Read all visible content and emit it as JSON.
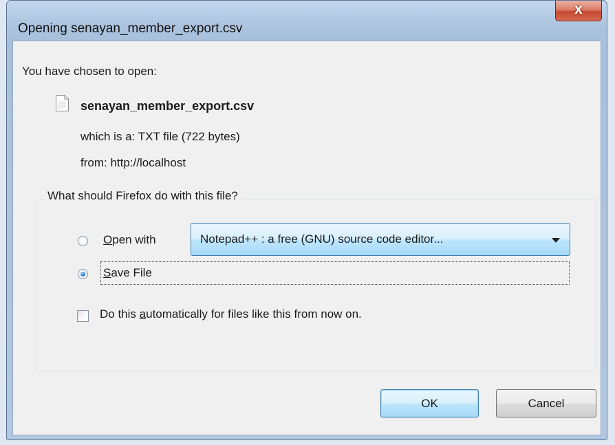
{
  "window": {
    "title": "Opening senayan_member_export.csv",
    "close_glyph": "x"
  },
  "dialog": {
    "prompt": "You have chosen to open:",
    "filename": "senayan_member_export.csv",
    "file_icon": "document-icon",
    "which_is": "which is a:  TXT file (722 bytes)",
    "from": "from:  http://localhost"
  },
  "group": {
    "legend": "What should Firefox do with this file?",
    "open_with": {
      "accel": "O",
      "rest": "pen with",
      "selected": false
    },
    "application": {
      "value": "Notepad++ : a free (GNU) source code editor..."
    },
    "save_file": {
      "accel": "S",
      "rest": "ave File",
      "selected": true
    },
    "auto": {
      "before": "Do this ",
      "accel": "a",
      "after": "utomatically for files like this from now on.",
      "checked": false
    }
  },
  "buttons": {
    "ok": "OK",
    "cancel": "Cancel"
  },
  "colors": {
    "accent": "#3c7fb1",
    "close": "#c44a30",
    "frame": "#b6cde6"
  }
}
